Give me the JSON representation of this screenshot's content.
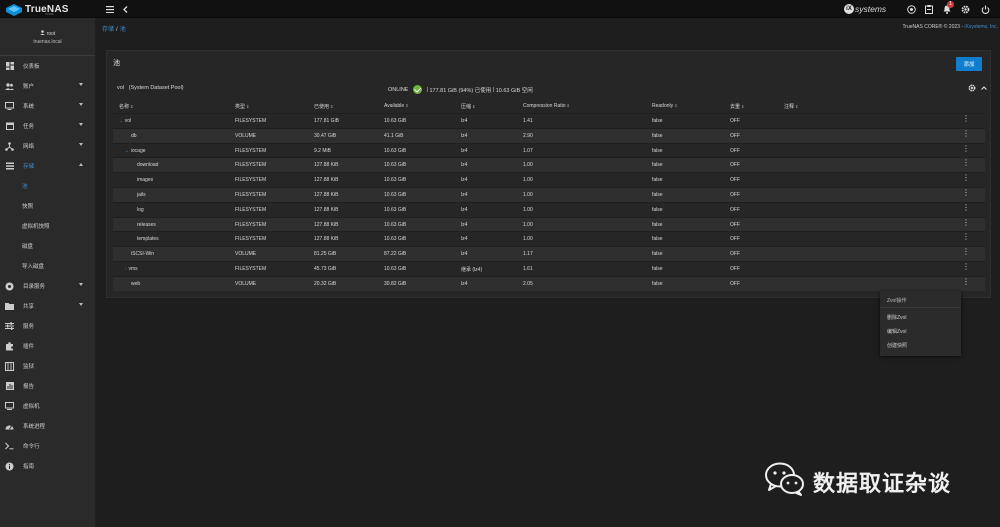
{
  "app": {
    "brand": "TrueNAS",
    "brand_sub": "CORE",
    "ixsystems": "systems",
    "alerts_count": "1",
    "copyright_prefix": "TrueNAS CORE® © 2023 - ",
    "copyright_link": "iXsystems, Inc."
  },
  "user": {
    "name": "root",
    "host": "truenas.local"
  },
  "sidebar": {
    "items": [
      {
        "label": "仪表板",
        "icon": "dashboard-icon"
      },
      {
        "label": "账户",
        "icon": "accounts-icon"
      },
      {
        "label": "系统",
        "icon": "computer-icon"
      },
      {
        "label": "任务",
        "icon": "calendar-icon"
      },
      {
        "label": "网络",
        "icon": "network-icon"
      },
      {
        "label": "存储",
        "icon": "storage-icon"
      },
      {
        "label": "目录服务",
        "icon": "directory-icon"
      },
      {
        "label": "共享",
        "icon": "share-icon"
      },
      {
        "label": "服务",
        "icon": "tune-icon"
      },
      {
        "label": "插件",
        "icon": "puzzle-icon"
      },
      {
        "label": "监狱",
        "icon": "jail-icon"
      },
      {
        "label": "报告",
        "icon": "chart-icon"
      },
      {
        "label": "虚拟机",
        "icon": "monitor-icon"
      },
      {
        "label": "系统进程",
        "icon": "gauge-icon"
      },
      {
        "label": "命令行",
        "icon": "shell-icon"
      },
      {
        "label": "指南",
        "icon": "info-icon"
      }
    ],
    "storage_sub": [
      "池",
      "快照",
      "虚拟机快照",
      "磁盘",
      "导入磁盘"
    ]
  },
  "breadcrumb": {
    "level1": "存储",
    "sep": "/",
    "level2": "池"
  },
  "card": {
    "title": "池",
    "add_label": "添加"
  },
  "pool": {
    "name": "vol",
    "desc": "(System Dataset Pool)",
    "status": "ONLINE",
    "usage": "177.81 GiB (94%) 已使用",
    "sep": "|",
    "free": "10.63 GiB 空闲"
  },
  "chart_data": {
    "type": "table",
    "columns": [
      "名称",
      "类型",
      "已使用",
      "Available",
      "压缩",
      "Compression Ratio",
      "Readonly",
      "去重",
      "注释"
    ],
    "rows": [
      {
        "name": "vol",
        "type": "FILESYSTEM",
        "used": "177.81 GiB",
        "avail": "10.63 GiB",
        "comp": "lz4",
        "ratio": "1.41",
        "ro": "false",
        "dedup": "OFF",
        "notes": ""
      },
      {
        "name": "db",
        "type": "VOLUME",
        "used": "30.47 GiB",
        "avail": "41.1 GiB",
        "comp": "lz4",
        "ratio": "2.90",
        "ro": "false",
        "dedup": "OFF",
        "notes": ""
      },
      {
        "name": "iocage",
        "type": "FILESYSTEM",
        "used": "9.2 MiB",
        "avail": "10.63 GiB",
        "comp": "lz4",
        "ratio": "1.07",
        "ro": "false",
        "dedup": "OFF",
        "notes": ""
      },
      {
        "name": "download",
        "type": "FILESYSTEM",
        "used": "127.88 KiB",
        "avail": "10.63 GiB",
        "comp": "lz4",
        "ratio": "1.00",
        "ro": "false",
        "dedup": "OFF",
        "notes": ""
      },
      {
        "name": "images",
        "type": "FILESYSTEM",
        "used": "127.88 KiB",
        "avail": "10.63 GiB",
        "comp": "lz4",
        "ratio": "1.00",
        "ro": "false",
        "dedup": "OFF",
        "notes": ""
      },
      {
        "name": "jails",
        "type": "FILESYSTEM",
        "used": "127.88 KiB",
        "avail": "10.63 GiB",
        "comp": "lz4",
        "ratio": "1.00",
        "ro": "false",
        "dedup": "OFF",
        "notes": ""
      },
      {
        "name": "log",
        "type": "FILESYSTEM",
        "used": "127.88 KiB",
        "avail": "10.63 GiB",
        "comp": "lz4",
        "ratio": "1.00",
        "ro": "false",
        "dedup": "OFF",
        "notes": ""
      },
      {
        "name": "releases",
        "type": "FILESYSTEM",
        "used": "127.88 KiB",
        "avail": "10.63 GiB",
        "comp": "lz4",
        "ratio": "1.00",
        "ro": "false",
        "dedup": "OFF",
        "notes": ""
      },
      {
        "name": "templates",
        "type": "FILESYSTEM",
        "used": "127.88 KiB",
        "avail": "10.63 GiB",
        "comp": "lz4",
        "ratio": "1.00",
        "ro": "false",
        "dedup": "OFF",
        "notes": ""
      },
      {
        "name": "iSCSI-Win",
        "type": "VOLUME",
        "used": "81.25 GiB",
        "avail": "87.22 GiB",
        "comp": "lz4",
        "ratio": "1.17",
        "ro": "false",
        "dedup": "OFF",
        "notes": ""
      },
      {
        "name": "vms",
        "type": "FILESYSTEM",
        "used": "45.73 GiB",
        "avail": "10.63 GiB",
        "comp": "继承 (lz4)",
        "ratio": "1.61",
        "ro": "false",
        "dedup": "OFF",
        "notes": ""
      },
      {
        "name": "web",
        "type": "VOLUME",
        "used": "20.32 GiB",
        "avail": "30.82 GiB",
        "comp": "lz4",
        "ratio": "2.05",
        "ro": "false",
        "dedup": "OFF",
        "notes": ""
      }
    ]
  },
  "popup": {
    "title": "Zvol操作",
    "items": [
      "删除Zvol",
      "编辑Zvol",
      "创建快照"
    ]
  },
  "watermark": {
    "text": "数据取证杂谈"
  }
}
